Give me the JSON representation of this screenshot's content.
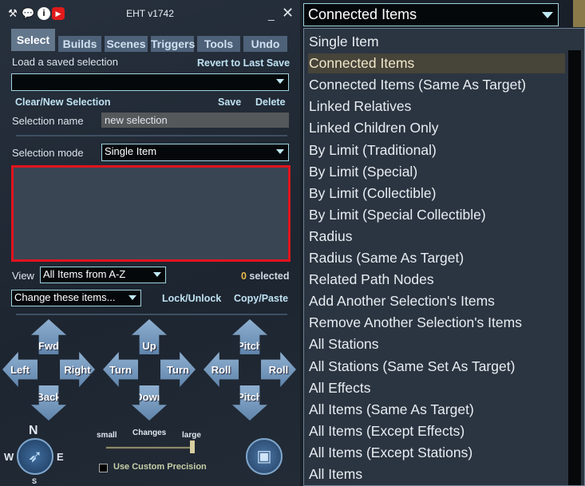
{
  "window": {
    "title": "EHT  v1742",
    "icons": [
      "tools-icon",
      "chat-icon",
      "info-icon",
      "youtube-icon"
    ]
  },
  "tabs": [
    {
      "label": "Select",
      "active": true
    },
    {
      "label": "Builds"
    },
    {
      "label": "Scenes"
    },
    {
      "label": "Triggers"
    },
    {
      "label": "Tools"
    },
    {
      "label": "Undo"
    }
  ],
  "load": {
    "label": "Load a saved selection",
    "revert": "Revert to Last Save",
    "value": ""
  },
  "actions": {
    "clear": "Clear/New Selection",
    "save": "Save",
    "delete": "Delete"
  },
  "selection_name": {
    "label": "Selection name",
    "value": "new selection"
  },
  "selection_mode": {
    "label": "Selection mode",
    "value": "Single Item"
  },
  "view": {
    "label": "View",
    "value": "All Items from A-Z",
    "count": "0",
    "count_suffix": " selected"
  },
  "change": {
    "value": "Change these items...",
    "lock": "Lock/Unlock",
    "copy": "Copy/Paste"
  },
  "move": {
    "fwd": "Fwd",
    "left": "Left",
    "right": "Right",
    "back": "Back",
    "up": "Up",
    "turn_l": "Turn",
    "turn_r": "Turn",
    "down": "Down",
    "pitch_u": "Pitch",
    "roll_l": "Roll",
    "roll_r": "Roll",
    "pitch_d": "Pitch"
  },
  "compass": {
    "n": "N",
    "w": "W",
    "e": "E",
    "s": "S"
  },
  "changes": {
    "small": "small",
    "label": "Changes",
    "large": "large",
    "level": 1.0
  },
  "custom_precision": {
    "label": "Use Custom Precision",
    "checked": false
  },
  "mode_dropdown": {
    "value": "Connected Items",
    "highlighted": 1,
    "options": [
      "Single Item",
      "Connected Items",
      "Connected Items (Same As Target)",
      "Linked Relatives",
      "Linked Children Only",
      "By Limit (Traditional)",
      "By Limit (Special)",
      "By Limit (Collectible)",
      "By Limit (Special Collectible)",
      "Radius",
      "Radius (Same As Target)",
      "Related Path Nodes",
      "Add Another Selection's Items",
      "Remove Another Selection's Items",
      "All Stations",
      "All Stations (Same Set As Target)",
      "All Effects",
      "All Items (Same As Target)",
      "All Items (Except Effects)",
      "All Items (Except Stations)",
      "All Items"
    ]
  },
  "colors": {
    "highlight": "#47443a",
    "selection_box_border": "#e0141e",
    "count": "#e8b84a"
  }
}
